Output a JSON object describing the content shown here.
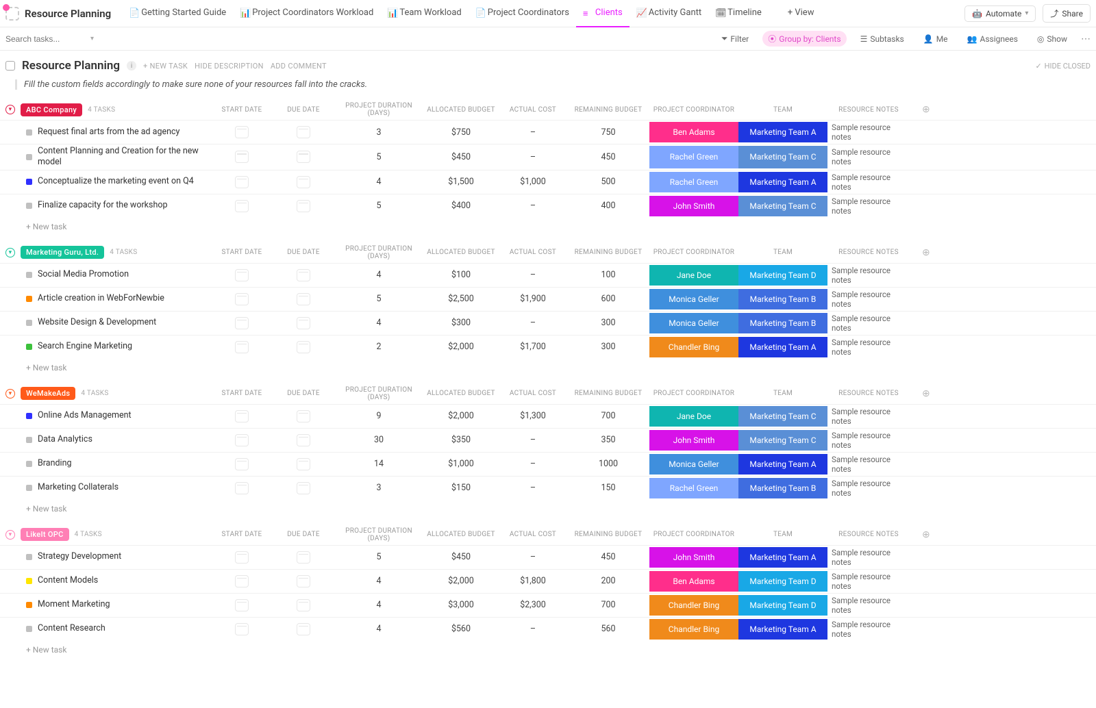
{
  "app": {
    "title": "Resource Planning"
  },
  "tabs": [
    {
      "label": "Getting Started Guide",
      "icon": "doc"
    },
    {
      "label": "Project Coordinators Workload",
      "icon": "workload"
    },
    {
      "label": "Team Workload",
      "icon": "workload"
    },
    {
      "label": "Project Coordinators",
      "icon": "doc"
    },
    {
      "label": "Clients",
      "icon": "list",
      "active": true
    },
    {
      "label": "Activity Gantt",
      "icon": "gantt"
    },
    {
      "label": "Timeline",
      "icon": "timeline"
    },
    {
      "label": "+ View",
      "icon": ""
    }
  ],
  "topButtons": {
    "automate": "Automate",
    "share": "Share"
  },
  "filterbar": {
    "searchPlaceholder": "Search tasks...",
    "filter": "Filter",
    "groupBy": "Group by: Clients",
    "subtasks": "Subtasks",
    "me": "Me",
    "assignees": "Assignees",
    "show": "Show"
  },
  "page": {
    "title": "Resource Planning",
    "newTask": "+ NEW TASK",
    "hideDescription": "HIDE DESCRIPTION",
    "addComment": "ADD COMMENT",
    "hideClosed": "HIDE CLOSED",
    "description": "Fill the custom fields accordingly to make sure none of your resources fall into the cracks."
  },
  "columns": {
    "name": "",
    "start": "START DATE",
    "due": "DUE DATE",
    "duration": "PROJECT DURATION (DAYS)",
    "budget": "ALLOCATED BUDGET",
    "actual": "ACTUAL COST",
    "remaining": "REMAINING BUDGET",
    "coordinator": "PROJECT COORDINATOR",
    "team": "TEAM",
    "notes": "RESOURCE NOTES"
  },
  "newTaskRow": "+ New task",
  "groups": [
    {
      "name": "ABC Company",
      "color": "#e11d48",
      "chev": "#e11d48",
      "count": "4 TASKS",
      "tasks": [
        {
          "name": "Request final arts from the ad agency",
          "status": "#c0c0c0",
          "duration": "3",
          "budget": "$750",
          "actual": "–",
          "remaining": "750",
          "coord": "Ben Adams",
          "coordColor": "#ff2e8b",
          "team": "Marketing Team A",
          "teamColor": "#1e37e0",
          "notes": "Sample resource notes"
        },
        {
          "name": "Content Planning and Creation for the new model",
          "status": "#c0c0c0",
          "duration": "5",
          "budget": "$450",
          "actual": "–",
          "remaining": "450",
          "coord": "Rachel Green",
          "coordColor": "#7fa6ff",
          "team": "Marketing Team C",
          "teamColor": "#5a8fd6",
          "notes": "Sample resource notes"
        },
        {
          "name": "Conceptualize the marketing event on Q4",
          "status": "#3030ff",
          "duration": "4",
          "budget": "$1,500",
          "actual": "$1,000",
          "remaining": "500",
          "coord": "Rachel Green",
          "coordColor": "#7fa6ff",
          "team": "Marketing Team A",
          "teamColor": "#1e37e0",
          "notes": "Sample resource notes"
        },
        {
          "name": "Finalize capacity for the workshop",
          "status": "#c0c0c0",
          "duration": "5",
          "budget": "$400",
          "actual": "–",
          "remaining": "400",
          "coord": "John Smith",
          "coordColor": "#d712e8",
          "team": "Marketing Team C",
          "teamColor": "#5a8fd6",
          "notes": "Sample resource notes"
        }
      ]
    },
    {
      "name": "Marketing Guru, Ltd.",
      "color": "#15c49a",
      "chev": "#15c49a",
      "count": "4 TASKS",
      "tasks": [
        {
          "name": "Social Media Promotion",
          "status": "#c0c0c0",
          "duration": "4",
          "budget": "$100",
          "actual": "–",
          "remaining": "100",
          "coord": "Jane Doe",
          "coordColor": "#0fb5b0",
          "team": "Marketing Team D",
          "teamColor": "#19a8e6",
          "notes": "Sample resource notes"
        },
        {
          "name": "Article creation in WebForNewbie",
          "status": "#ff8a00",
          "duration": "5",
          "budget": "$2,500",
          "actual": "$1,900",
          "remaining": "600",
          "coord": "Monica Geller",
          "coordColor": "#3f8fdd",
          "team": "Marketing Team B",
          "teamColor": "#3f6de0",
          "notes": "Sample resource notes"
        },
        {
          "name": "Website Design & Development",
          "status": "#c0c0c0",
          "duration": "4",
          "budget": "$300",
          "actual": "–",
          "remaining": "300",
          "coord": "Monica Geller",
          "coordColor": "#3f8fdd",
          "team": "Marketing Team B",
          "teamColor": "#3f6de0",
          "notes": "Sample resource notes"
        },
        {
          "name": "Search Engine Marketing",
          "status": "#3cc13c",
          "duration": "2",
          "budget": "$2,000",
          "actual": "$1,700",
          "remaining": "300",
          "coord": "Chandler Bing",
          "coordColor": "#f08a1b",
          "team": "Marketing Team A",
          "teamColor": "#1e37e0",
          "notes": "Sample resource notes"
        }
      ]
    },
    {
      "name": "WeMakeAds",
      "color": "#ff5a1a",
      "chev": "#ff5a1a",
      "count": "4 TASKS",
      "tasks": [
        {
          "name": "Online Ads Management",
          "status": "#3030ff",
          "duration": "9",
          "budget": "$2,000",
          "actual": "$1,300",
          "remaining": "700",
          "coord": "Jane Doe",
          "coordColor": "#0fb5b0",
          "team": "Marketing Team C",
          "teamColor": "#5a8fd6",
          "notes": "Sample resource notes"
        },
        {
          "name": "Data Analytics",
          "status": "#c0c0c0",
          "duration": "30",
          "budget": "$350",
          "actual": "–",
          "remaining": "350",
          "coord": "John Smith",
          "coordColor": "#d712e8",
          "team": "Marketing Team C",
          "teamColor": "#5a8fd6",
          "notes": "Sample resource notes"
        },
        {
          "name": "Branding",
          "status": "#c0c0c0",
          "duration": "14",
          "budget": "$1,000",
          "actual": "–",
          "remaining": "1000",
          "coord": "Monica Geller",
          "coordColor": "#3f8fdd",
          "team": "Marketing Team A",
          "teamColor": "#1e37e0",
          "notes": "Sample resource notes"
        },
        {
          "name": "Marketing Collaterals",
          "status": "#c0c0c0",
          "duration": "3",
          "budget": "$150",
          "actual": "–",
          "remaining": "150",
          "coord": "Rachel Green",
          "coordColor": "#7fa6ff",
          "team": "Marketing Team B",
          "teamColor": "#3f6de0",
          "notes": "Sample resource notes"
        }
      ]
    },
    {
      "name": "LikeIt OPC",
      "color": "#ff7fb5",
      "chev": "#ff7fb5",
      "count": "4 TASKS",
      "tasks": [
        {
          "name": "Strategy Development",
          "status": "#c0c0c0",
          "duration": "5",
          "budget": "$450",
          "actual": "–",
          "remaining": "450",
          "coord": "John Smith",
          "coordColor": "#d712e8",
          "team": "Marketing Team A",
          "teamColor": "#1e37e0",
          "notes": "Sample resource notes"
        },
        {
          "name": "Content Models",
          "status": "#ffe600",
          "duration": "4",
          "budget": "$2,000",
          "actual": "$1,800",
          "remaining": "200",
          "coord": "Ben Adams",
          "coordColor": "#ff2e8b",
          "team": "Marketing Team D",
          "teamColor": "#19a8e6",
          "notes": "Sample resource notes"
        },
        {
          "name": "Moment Marketing",
          "status": "#ff8a00",
          "duration": "4",
          "budget": "$3,000",
          "actual": "$2,300",
          "remaining": "700",
          "coord": "Chandler Bing",
          "coordColor": "#f08a1b",
          "team": "Marketing Team D",
          "teamColor": "#19a8e6",
          "notes": "Sample resource notes"
        },
        {
          "name": "Content Research",
          "status": "#c0c0c0",
          "duration": "4",
          "budget": "$560",
          "actual": "–",
          "remaining": "560",
          "coord": "Chandler Bing",
          "coordColor": "#f08a1b",
          "team": "Marketing Team A",
          "teamColor": "#1e37e0",
          "notes": "Sample resource notes"
        }
      ]
    }
  ]
}
